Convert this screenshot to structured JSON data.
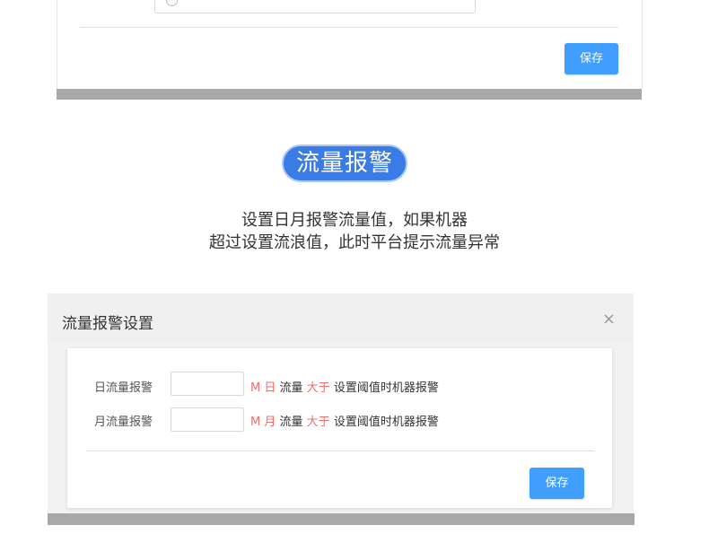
{
  "top_panel": {
    "save_label": "保存"
  },
  "feature": {
    "title": "流量报警",
    "description_line1": "设置日月报警流量值，如果机器",
    "description_line2": "超过设置流浪值，此时平台提示流量异常"
  },
  "dialog": {
    "title": "流量报警设置",
    "close_symbol": "×",
    "rows": [
      {
        "label": "日流量报警",
        "value": "",
        "unit": "M",
        "period": "日",
        "text1": "流量",
        "comparator": "大于",
        "text2": "设置阈值时机器报警"
      },
      {
        "label": "月流量报警",
        "value": "",
        "unit": "M",
        "period": "月",
        "text1": "流量",
        "comparator": "大于",
        "text2": "设置阈值时机器报警"
      }
    ],
    "save_label": "保存"
  },
  "colors": {
    "primary": "#409eff",
    "pill": "#3a7be4",
    "accent_red": "#f56c6c",
    "bar_gray": "#a8a8a8"
  }
}
